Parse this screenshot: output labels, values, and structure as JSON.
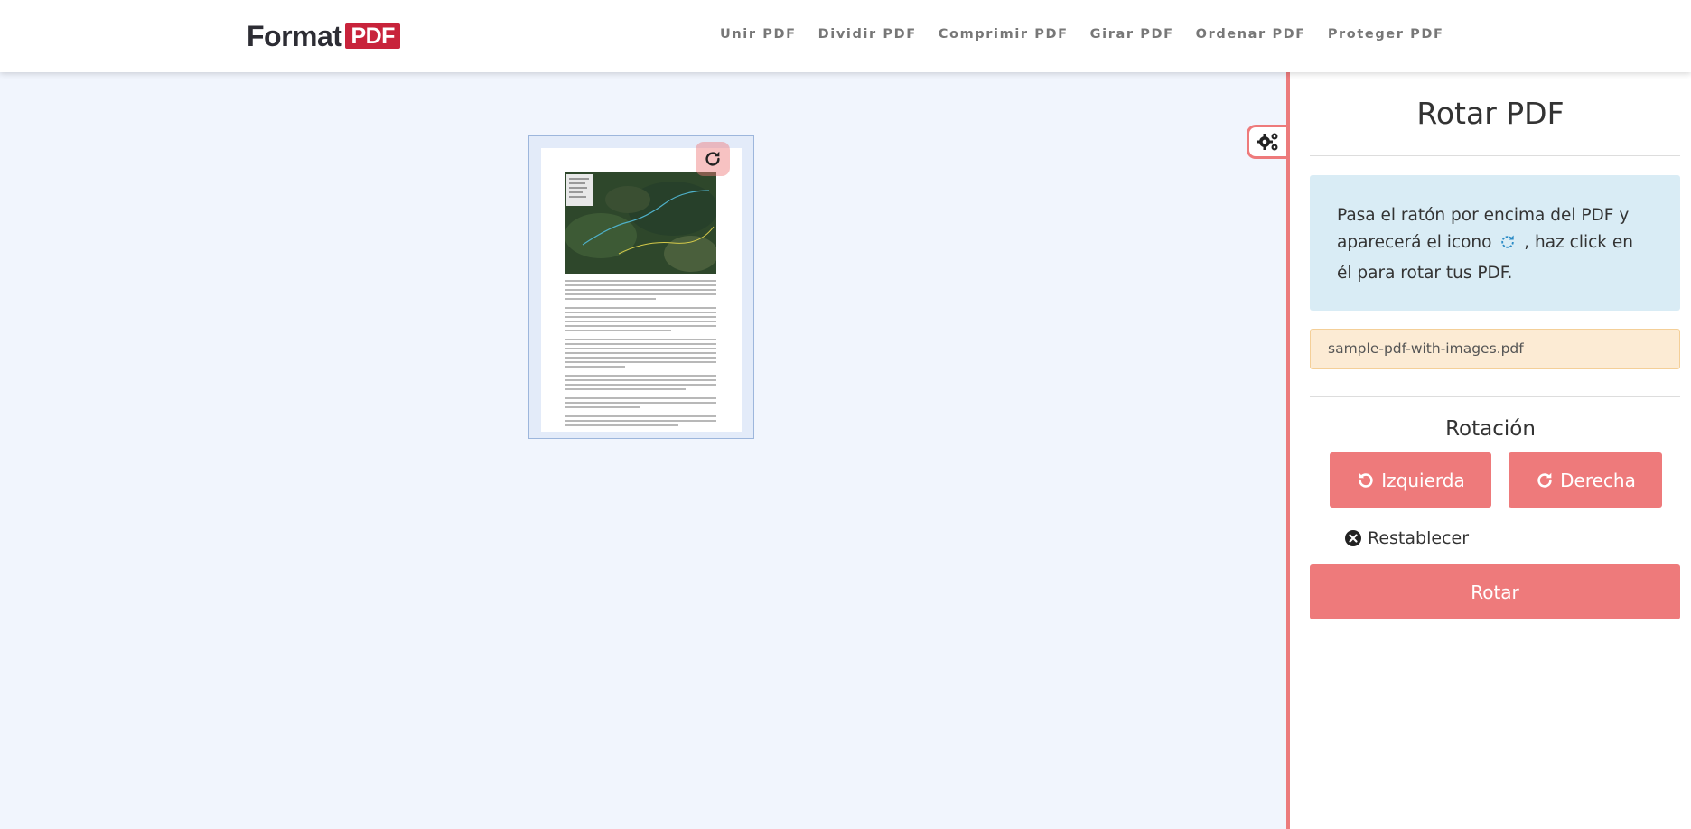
{
  "header": {
    "logo": {
      "word": "Format",
      "badge": "PDF"
    },
    "nav": [
      {
        "label": "Unir PDF"
      },
      {
        "label": "Dividir PDF"
      },
      {
        "label": "Comprimir PDF"
      },
      {
        "label": "Girar PDF"
      },
      {
        "label": "Ordenar PDF"
      },
      {
        "label": "Proteger PDF"
      }
    ]
  },
  "workspace": {
    "thumbnail": {
      "rotate_icon": "rotate-cw-icon"
    }
  },
  "sidebar": {
    "title": "Rotar PDF",
    "info": {
      "text_before": "Pasa el ratón por encima del PDF y aparecerá el icono",
      "icon": "rotate-cw-icon",
      "text_after": ", haz click en él para rotar tus PDF."
    },
    "file_name": "sample-pdf-with-images.pdf",
    "rotation_label": "Rotación",
    "left_button": "Izquierda",
    "right_button": "Derecha",
    "reset_label": "Restablecer",
    "rotate_button": "Rotar",
    "toggle_icon": "gears-icon"
  },
  "colors": {
    "accent": "#ee7a7b",
    "logo_badge": "#c8233b",
    "info_bg": "#d9ecf5",
    "file_bg": "#fcebd4",
    "workspace_bg": "#f1f5fd"
  }
}
